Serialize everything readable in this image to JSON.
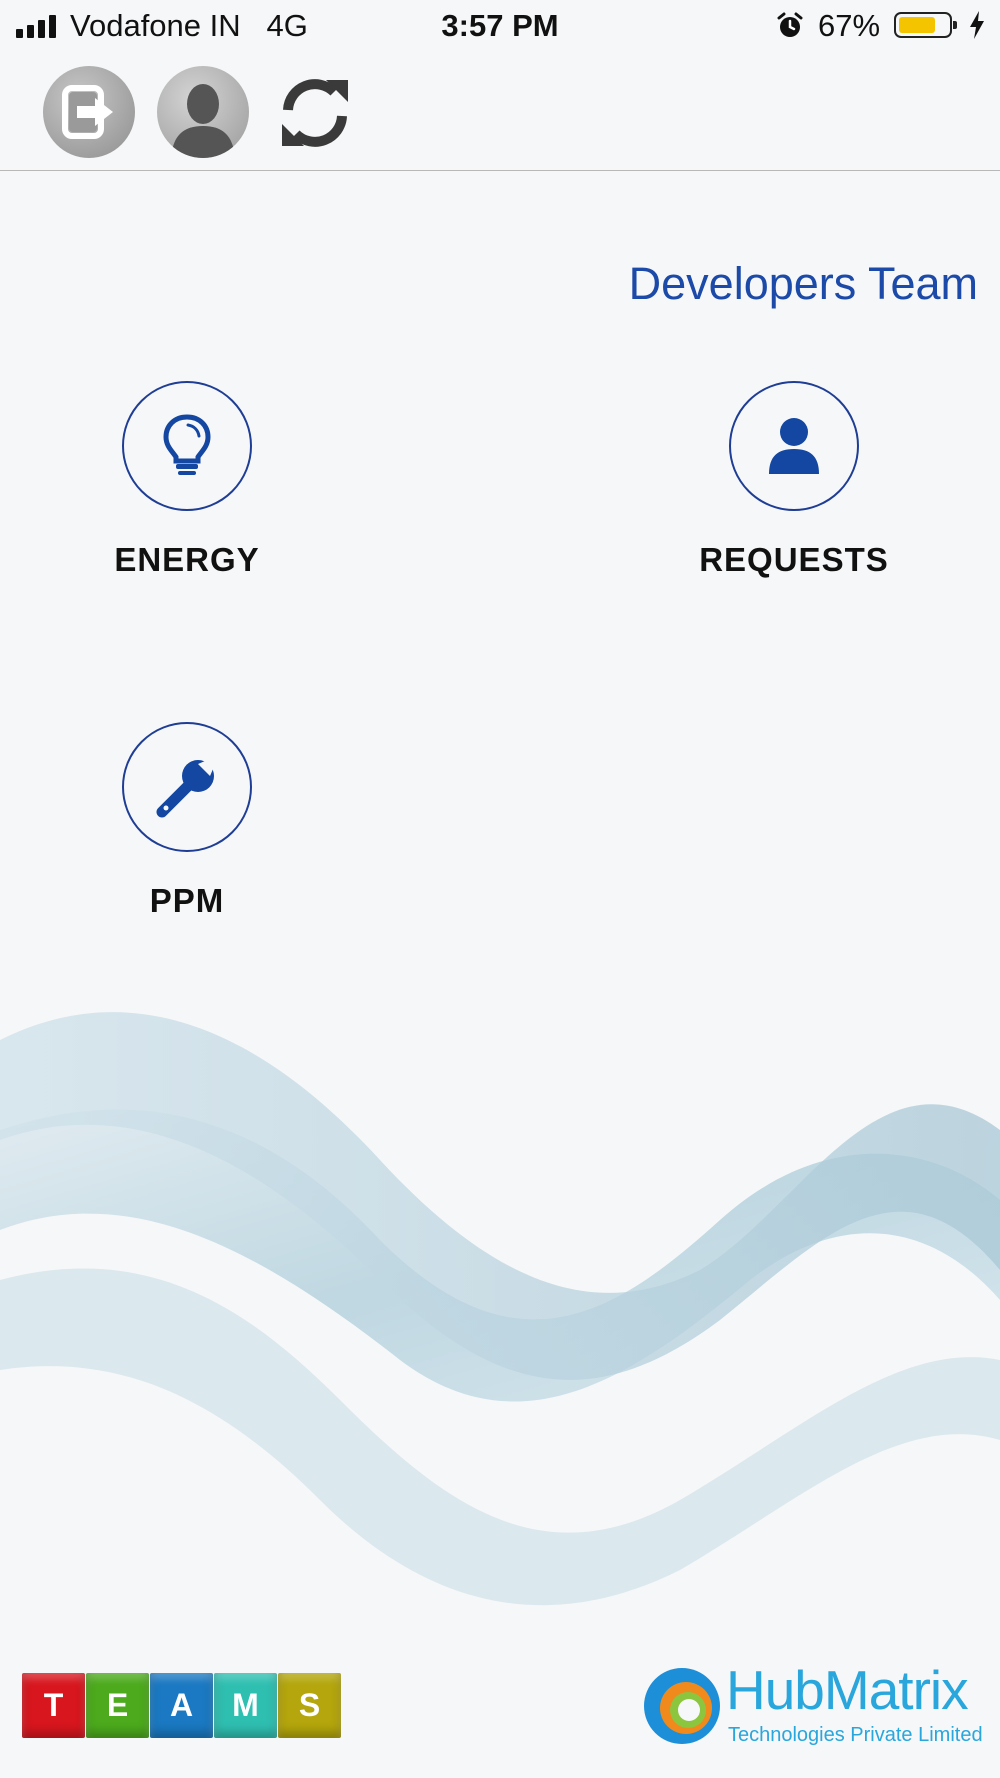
{
  "status_bar": {
    "carrier": "Vodafone IN",
    "network": "4G",
    "time": "3:57 PM",
    "battery_percent": "67%",
    "battery_level": 0.67,
    "battery_color": "#f5c400"
  },
  "toolbar": {
    "buttons": [
      {
        "name": "logout",
        "icon": "logout-icon"
      },
      {
        "name": "profile",
        "icon": "user-avatar-icon"
      },
      {
        "name": "refresh",
        "icon": "refresh-icon"
      }
    ]
  },
  "team_name": "Developers Team",
  "tiles": [
    {
      "label": "ENERGY",
      "icon": "lightbulb-icon"
    },
    {
      "label": "REQUESTS",
      "icon": "user-icon"
    },
    {
      "label": "PPM",
      "icon": "wrench-icon"
    }
  ],
  "footer": {
    "teams_letters": [
      "T",
      "E",
      "A",
      "M",
      "S"
    ],
    "teams_colors": [
      "#d8161e",
      "#4caa1c",
      "#1a79c2",
      "#2fbfb1",
      "#b4a60c"
    ],
    "hub_name": "HubMatrix",
    "hub_subtitle": "Technologies Private Limited"
  },
  "colors": {
    "accent": "#1c4aa8",
    "icon_blue": "#1347a2",
    "hub_blue": "#29a6dc"
  }
}
